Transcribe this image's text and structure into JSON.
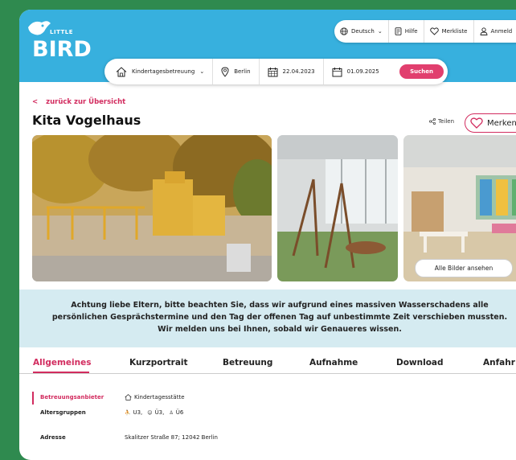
{
  "brand": {
    "little": "LITTLE",
    "bird": "BIRD"
  },
  "topnav": {
    "language": "Deutsch",
    "help": "Hilfe",
    "watchlist": "Merkliste",
    "login": "Anmeld"
  },
  "search": {
    "category": "Kindertagesbetreuung",
    "location": "Berlin",
    "date_from": "22.04.2023",
    "date_to": "01.09.2025",
    "button": "Suchen"
  },
  "back_link": "zurück zur Übersicht",
  "title": "Kita Vogelhaus",
  "share": "Teilen",
  "favorite": "Merken",
  "all_pictures": "Alle Bilder ansehen",
  "notice": "Achtung liebe Eltern, bitte beachten Sie, dass wir aufgrund eines massiven Wasserschadens alle persönlichen Gesprächstermine und den Tag der offenen Tag auf unbestimmte Zeit verschieben mussten. Wir melden uns bei Ihnen, sobald wir Genaueres wissen.",
  "tabs": [
    "Allgemeines",
    "Kurzportrait",
    "Betreuung",
    "Aufnahme",
    "Download",
    "Anfahr"
  ],
  "details": {
    "provider_label": "Betreuungsanbieter",
    "provider_value": "Kindertagesstätte",
    "age_label": "Altersgruppen",
    "age_u3": "U3,",
    "age_ue3": "Ü3,",
    "age_ue6": "Ü6",
    "address_label": "Adresse",
    "address_value": "Skalitzer Straße 87; 12042 Berlin"
  },
  "colors": {
    "header": "#37b0de",
    "accent": "#d22c5f",
    "notice_bg": "#d5ebf1",
    "outer": "#2f8a4f"
  }
}
